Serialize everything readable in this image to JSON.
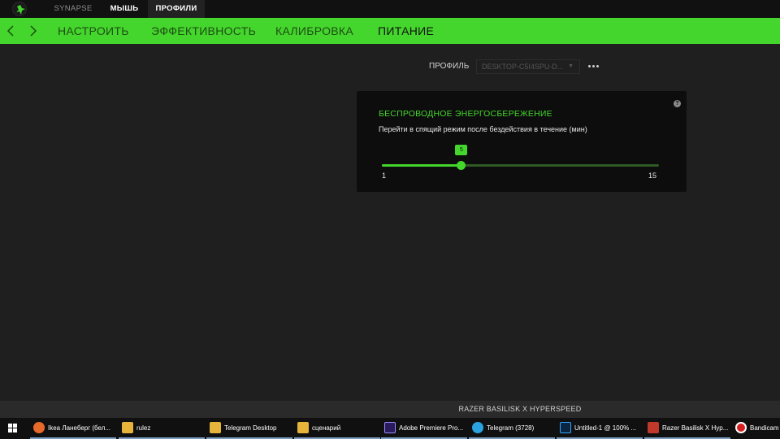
{
  "titlebar": {
    "tabs": [
      {
        "label": "SYNAPSE"
      },
      {
        "label": "МЫШЬ"
      },
      {
        "label": "ПРОФИЛИ"
      }
    ]
  },
  "nav": {
    "tabs": [
      {
        "label": "НАСТРОИТЬ"
      },
      {
        "label": "ЭФФЕКТИВНОСТЬ"
      },
      {
        "label": "КАЛИБРОВКА"
      },
      {
        "label": "ПИТАНИЕ"
      }
    ],
    "active_tab": "ПИТАНИЕ"
  },
  "profile": {
    "label": "ПРОФИЛЬ",
    "selected": "DESKTOP-C5I4SPU-D..."
  },
  "power_card": {
    "title": "БЕСПРОВОДНОЕ ЭНЕРГОСБЕРЕЖЕНИЕ",
    "description": "Перейти в спящий режим после бездействия в течение (мин)",
    "help": "?",
    "slider": {
      "min": 1,
      "max": 15,
      "value": 5,
      "min_label": "1",
      "max_label": "15",
      "value_label": "5"
    }
  },
  "footer": {
    "device_name": "RAZER BASILISK X HYPERSPEED"
  },
  "colors": {
    "accent": "#44d62c",
    "background": "#1f1f1f",
    "card": "#0d0d0d"
  },
  "taskbar": {
    "items": [
      {
        "label": "Ikea Ланеберг (бел...",
        "icon": "firefox-icon"
      },
      {
        "label": "rulez",
        "icon": "folder-icon"
      },
      {
        "label": "Telegram Desktop",
        "icon": "folder-icon"
      },
      {
        "label": "сценарий",
        "icon": "folder-icon"
      },
      {
        "label": "Adobe Premiere Pro...",
        "icon": "premiere-icon"
      },
      {
        "label": "Telegram (3728)",
        "icon": "telegram-icon"
      },
      {
        "label": "Untitled-1 @ 100% ...",
        "icon": "photoshop-icon"
      },
      {
        "label": "Razer Basilisk X Hyp...",
        "icon": "razer-synapse-icon"
      },
      {
        "label": "Bandicam",
        "icon": "bandicam-icon"
      }
    ]
  }
}
